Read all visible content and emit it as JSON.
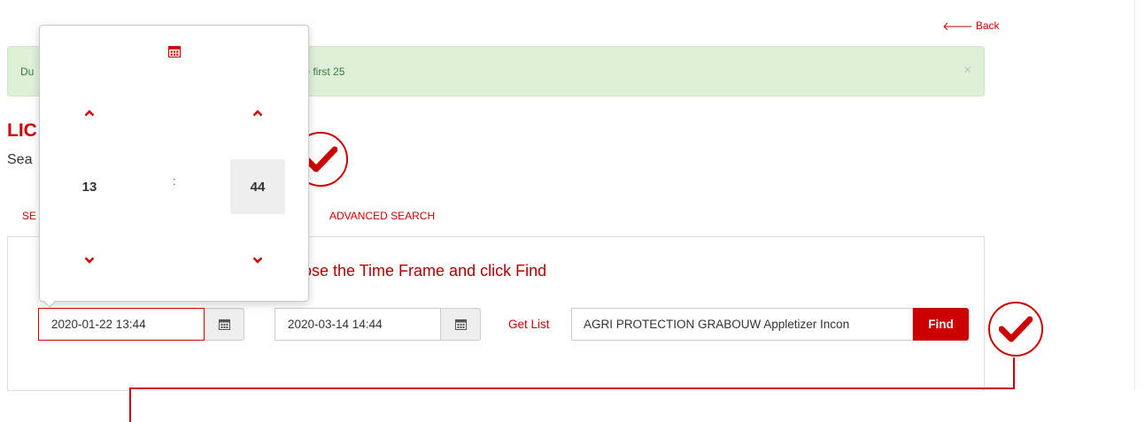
{
  "nav": {
    "back_label": "Back"
  },
  "alert": {
    "text_before": "Du",
    "text_after": "e first 25"
  },
  "header": {
    "title": "LIC",
    "subtitle": "Sea"
  },
  "tabs": [
    {
      "label": "SE"
    },
    {
      "label": "ADVANCED SEARCH"
    }
  ],
  "search": {
    "heading": "ose the Time Frame and click Find",
    "from_date": "2020-01-22 13:44",
    "to_date": "2020-03-14 14:44",
    "get_list_label": "Get List",
    "company_value": "AGRI PROTECTION GRABOUW Appletizer Incon",
    "find_label": "Find"
  },
  "time_picker": {
    "hour": "13",
    "separator": ":",
    "minute": "44"
  },
  "icons": {
    "calendar": "calendar-icon",
    "chevron_up": "chevron-up-icon",
    "chevron_down": "chevron-down-icon",
    "checkmark": "checkmark-icon",
    "close": "close-icon",
    "back_arrow": "arrow-left-icon"
  },
  "colors": {
    "accent": "#cc0000",
    "alert_bg": "#dff0d8",
    "alert_text": "#3c763d",
    "selected_bg": "#eeeeee"
  }
}
